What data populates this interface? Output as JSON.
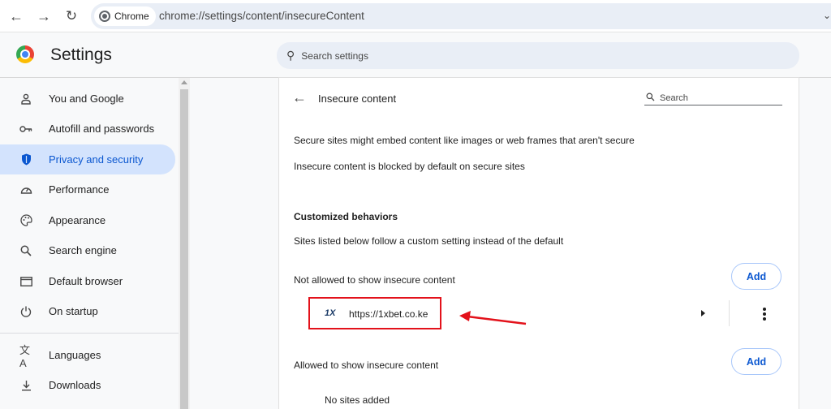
{
  "browser": {
    "chip_label": "Chrome",
    "url": "chrome://settings/content/insecureContent"
  },
  "header": {
    "title": "Settings",
    "search_placeholder": "Search settings"
  },
  "sidebar": {
    "items": [
      {
        "label": "You and Google",
        "icon": "person-icon"
      },
      {
        "label": "Autofill and passwords",
        "icon": "key-icon"
      },
      {
        "label": "Privacy and security",
        "icon": "shield-icon",
        "active": true
      },
      {
        "label": "Performance",
        "icon": "gauge-icon"
      },
      {
        "label": "Appearance",
        "icon": "palette-icon"
      },
      {
        "label": "Search engine",
        "icon": "search-icon"
      },
      {
        "label": "Default browser",
        "icon": "browser-window-icon"
      },
      {
        "label": "On startup",
        "icon": "power-icon"
      },
      {
        "label": "Languages",
        "icon": "translate-icon"
      },
      {
        "label": "Downloads",
        "icon": "download-icon"
      }
    ]
  },
  "page": {
    "title": "Insecure content",
    "search_placeholder": "Search",
    "desc1": "Secure sites might embed content like images or web frames that aren't secure",
    "desc2": "Insecure content is blocked by default on secure sites",
    "customized_title": "Customized behaviors",
    "customized_desc": "Sites listed below follow a custom setting instead of the default",
    "not_allowed_label": "Not allowed to show insecure content",
    "allowed_label": "Allowed to show insecure content",
    "add_label": "Add",
    "blocked_site": {
      "favicon_text": "1X",
      "url": "https://1xbet.co.ke"
    },
    "no_sites": "No sites added"
  },
  "annotation_color": "#e3121b"
}
